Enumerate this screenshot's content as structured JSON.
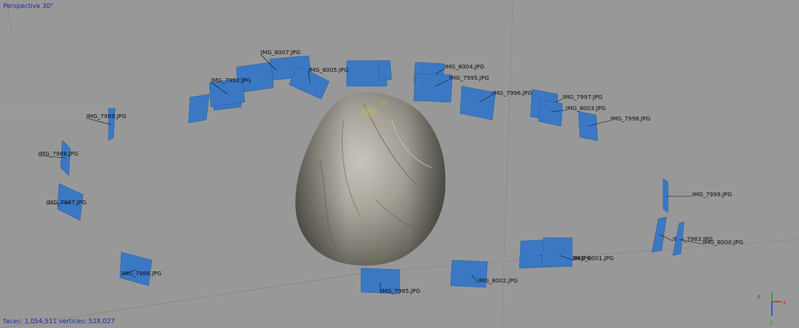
{
  "viewport": {
    "view_label": "Perspective 30°",
    "stats": "faces: 1,054,511 vertices: 528,027"
  },
  "colors": {
    "background": "#989898",
    "camera_plane": "#3b78c4",
    "hud_text": "#1a2ab0",
    "axis_x": "#e02020",
    "axis_y": "#20a020",
    "axis_z": "#2040e0"
  },
  "cameras": [
    {
      "label": "IMG_8007.JPG"
    },
    {
      "label": "IMG_8005.JPG"
    },
    {
      "label": "IMG_7992.JPG"
    },
    {
      "label": "IMG_8004.JPG"
    },
    {
      "label": "IMG_7995.JPG"
    },
    {
      "label": "IMG_7996.JPG"
    },
    {
      "label": "IMG_7997.JPG"
    },
    {
      "label": "IMG_8003.JPG"
    },
    {
      "label": "IMG_7998.JPG"
    },
    {
      "label": "IMG_7989.JPG"
    },
    {
      "label": "IMG_7988.JPG"
    },
    {
      "label": "IMG_7987.JPG"
    },
    {
      "label": "IMG_7986.JPG"
    },
    {
      "label": "IMG_7985.JPG"
    },
    {
      "label": "IMG_8002.JPG"
    },
    {
      "label": "IMG_7984.JPG"
    },
    {
      "label": "IMG_8001.JPG"
    },
    {
      "label": "IMG_7999.JPG"
    },
    {
      "label": "IMG_7983.JPG"
    },
    {
      "label": "IMG_8000.JPG"
    }
  ],
  "gizmo": {
    "axes": [
      "x",
      "y",
      "z"
    ]
  }
}
